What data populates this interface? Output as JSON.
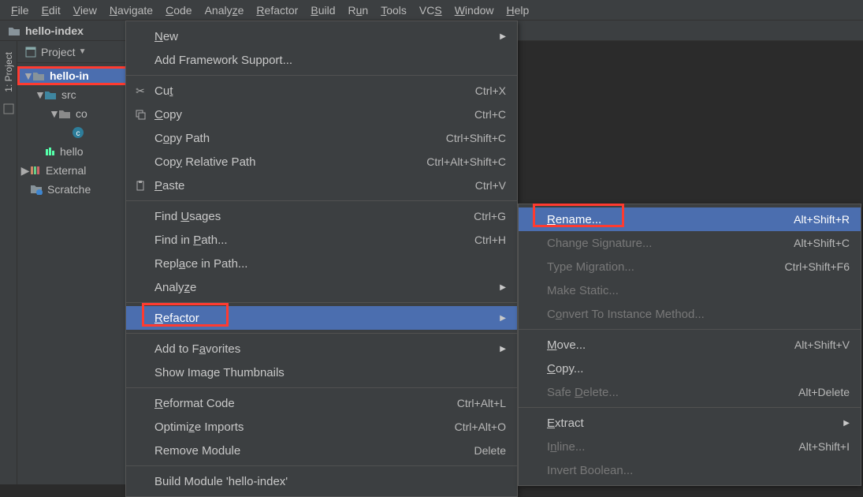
{
  "menubar": [
    "File",
    "Edit",
    "View",
    "Navigate",
    "Code",
    "Analyze",
    "Refactor",
    "Build",
    "Run",
    "Tools",
    "VCS",
    "Window",
    "Help"
  ],
  "breadcrumb": {
    "project": "hello-index"
  },
  "sidebar_tab": "1: Project",
  "project_panel": {
    "title": "Project"
  },
  "tree": {
    "root": "hello-in",
    "src": "src",
    "pkg": "co",
    "iml": "hello",
    "ext": "External",
    "scratch": "Scratche"
  },
  "menu1": {
    "new": "New",
    "add_fw": "Add Framework Support...",
    "cut": "Cut",
    "cut_sc": "Ctrl+X",
    "copy": "Copy",
    "copy_sc": "Ctrl+C",
    "copy_path": "Copy Path",
    "copy_path_sc": "Ctrl+Shift+C",
    "copy_rel": "Copy Relative Path",
    "copy_rel_sc": "Ctrl+Alt+Shift+C",
    "paste": "Paste",
    "paste_sc": "Ctrl+V",
    "find_usages": "Find Usages",
    "find_usages_sc": "Ctrl+G",
    "find_in_path": "Find in Path...",
    "find_in_path_sc": "Ctrl+H",
    "replace_in_path": "Replace in Path...",
    "analyze": "Analyze",
    "refactor": "Refactor",
    "add_fav": "Add to Favorites",
    "show_thumbs": "Show Image Thumbnails",
    "reformat": "Reformat Code",
    "reformat_sc": "Ctrl+Alt+L",
    "opt_imports": "Optimize Imports",
    "opt_imports_sc": "Ctrl+Alt+O",
    "remove_mod": "Remove Module",
    "remove_mod_sc": "Delete",
    "build_mod": "Build Module 'hello-index'"
  },
  "menu2": {
    "rename": "Rename...",
    "rename_sc": "Alt+Shift+R",
    "change_sig": "Change Signature...",
    "change_sig_sc": "Alt+Shift+C",
    "type_mig": "Type Migration...",
    "type_mig_sc": "Ctrl+Shift+F6",
    "make_static": "Make Static...",
    "conv_inst": "Convert To Instance Method...",
    "move": "Move...",
    "move_sc": "Alt+Shift+V",
    "copy": "Copy...",
    "safe_del": "Safe Delete...",
    "safe_del_sc": "Alt+Delete",
    "extract": "Extract",
    "inline": "Inline...",
    "inline_sc": "Alt+Shift+I",
    "invert_bool": "Invert Boolean..."
  }
}
